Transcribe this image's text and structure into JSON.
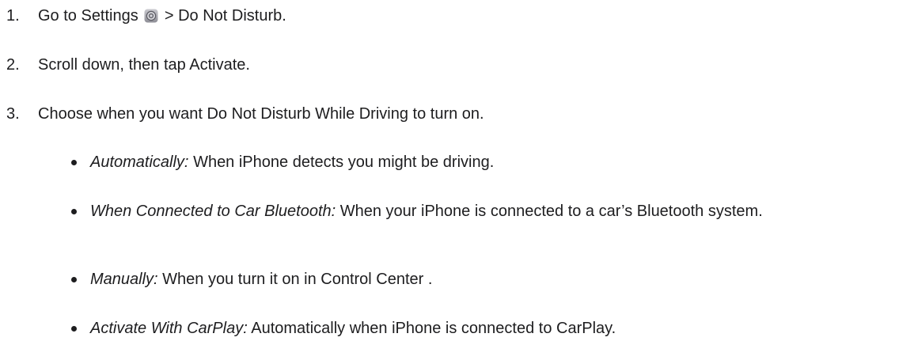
{
  "steps": [
    {
      "number": "1.",
      "before_icon": "Go to Settings",
      "icon": "settings-gear-icon",
      "after_icon": "> Do Not Disturb."
    },
    {
      "number": "2.",
      "text": "Scroll down, then tap Activate."
    },
    {
      "number": "3.",
      "text": "Choose when you want Do Not Disturb While Driving to turn on."
    }
  ],
  "options": [
    {
      "term": "Automatically:",
      "description": "When iPhone detects you might be driving."
    },
    {
      "term": "When Connected to Car Bluetooth:",
      "description": "When your iPhone is connected to a car’s Bluetooth system."
    },
    {
      "term": "Manually:",
      "description": "When you turn it on in Control Center ."
    },
    {
      "term": "Activate With CarPlay:",
      "description": "Automatically when iPhone is connected to CarPlay."
    }
  ]
}
